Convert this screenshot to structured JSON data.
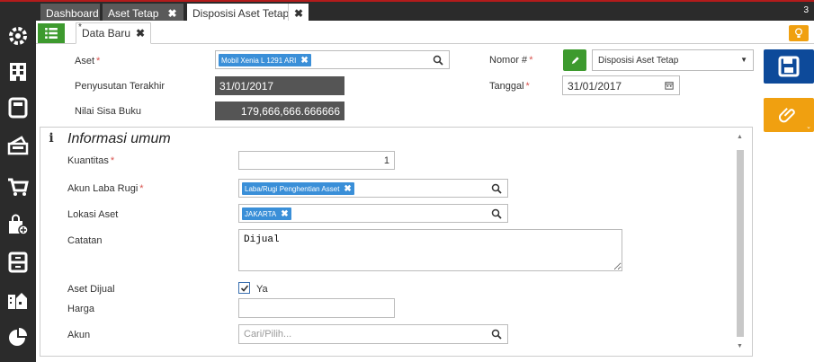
{
  "tabs": {
    "dashboard": "Dashboard",
    "aset_tetap": "Aset Tetap",
    "disposisi": "Disposisi Aset Tetap",
    "count": "3"
  },
  "doc_tab": {
    "star": "*",
    "label": "Data Baru"
  },
  "form": {
    "aset_label": "Aset",
    "aset_value": "Mobil Xenia L 1291 ARI",
    "penyusutan_label": "Penyusutan Terakhir",
    "penyusutan_value": "31/01/2017",
    "nilai_label": "Nilai Sisa Buku",
    "nilai_value": "179,666,666.666666",
    "nomor_label": "Nomor #",
    "nomor_type": "Disposisi Aset Tetap",
    "tanggal_label": "Tanggal",
    "tanggal_value": "31/01/2017",
    "required_mark": "*"
  },
  "panel": {
    "indicator": "i",
    "title": "Informasi umum",
    "kuantitas_label": "Kuantitas",
    "kuantitas_value": "1",
    "akun_laba_label": "Akun Laba Rugi",
    "akun_laba_value": "Laba/Rugi Penghentian Asset",
    "lokasi_label": "Lokasi Aset",
    "lokasi_value": "JAKARTA",
    "catatan_label": "Catatan",
    "catatan_value": "Dijual",
    "aset_dijual_label": "Aset Dijual",
    "aset_dijual_check": "Ya",
    "harga_label": "Harga",
    "akun_label": "Akun",
    "akun_placeholder": "Cari/Pilih..."
  },
  "colors": {
    "brand_red": "#b31b1b",
    "green": "#3d9a2e",
    "blue": "#0d4a9a",
    "orange": "#f0a010",
    "chip_blue": "#3a8fd8"
  },
  "icons": [
    "settings-icon",
    "building-icon",
    "calculator-icon",
    "money-icon",
    "cart-icon",
    "shopping-bag-icon",
    "archive-icon",
    "city-icon",
    "pie-chart-icon"
  ]
}
